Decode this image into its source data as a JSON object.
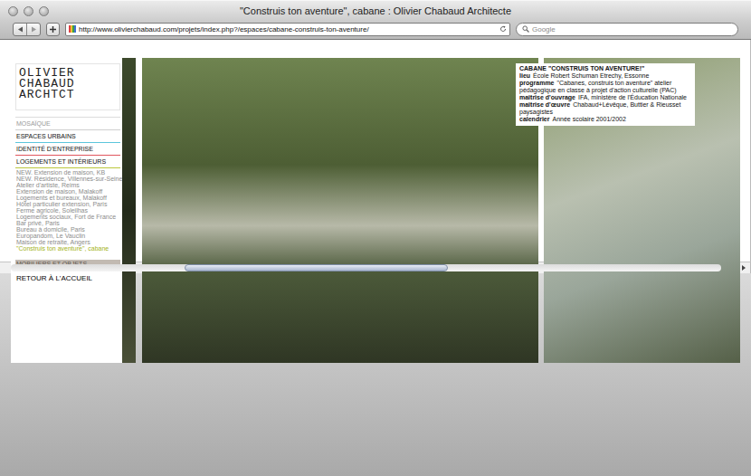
{
  "window": {
    "title": "\"Construis ton aventure\", cabane : Olivier Chabaud Architecte"
  },
  "toolbar": {
    "url": "http://www.olivierchabaud.com/projets/index.php?/espaces/cabane-construis-ton-aventure/",
    "search_placeholder": "Google"
  },
  "menu": {
    "logo": [
      "OLIVIER",
      "CHABAUD",
      "ARCHTCT"
    ],
    "items": [
      {
        "kind": "section",
        "label": "MOSAÏQUE",
        "muted": true,
        "color": "#cfcfcf"
      },
      {
        "kind": "section",
        "label": "ESPACES URBAINS",
        "muted": false,
        "color": "#5cc6dc"
      },
      {
        "kind": "section",
        "label": "IDENTITÉ D'ENTREPRISE",
        "muted": false,
        "color": "#e0565e"
      },
      {
        "kind": "section",
        "label": "LOGEMENTS ET INTÉRIEURS",
        "muted": false,
        "color": "#bcc83c",
        "children": [
          {
            "label": "NEW. Extension de maison, KB",
            "selected": false
          },
          {
            "label": "NEW. Résidence, Villennes-sur-Seine",
            "selected": false
          },
          {
            "label": "Atelier d'artiste, Reims",
            "selected": false
          },
          {
            "label": "Extension de maison, Malakoff",
            "selected": false
          },
          {
            "label": "Logements et bureaux, Malakoff",
            "selected": false
          },
          {
            "label": "Hôtel particulier extension, Paris",
            "selected": false
          },
          {
            "label": "Ferme agricole, Soleilhas",
            "selected": false
          },
          {
            "label": "Logements sociaux, Fort de France",
            "selected": false
          },
          {
            "label": "Bar privé, Paris",
            "selected": false
          },
          {
            "label": "Bureau à domicile, Paris",
            "selected": false
          },
          {
            "label": "Europandom, Le Vauclin",
            "selected": false
          },
          {
            "label": "Maison de retraite, Angers",
            "selected": false
          },
          {
            "label": "\"Construis ton aventure\", cabane",
            "selected": true
          }
        ]
      },
      {
        "kind": "bar",
        "label": "MOBILIERS ET OBJETS",
        "muted": true,
        "color": "#c2bab2"
      },
      {
        "kind": "link",
        "label": "RETOUR À L'ACCUEIL",
        "muted": false,
        "color": "#000000"
      }
    ]
  },
  "info": {
    "title": "CABANE \"CONSTRUIS TON AVENTURE!\"",
    "rows": [
      {
        "label": "lieu",
        "value": "École Robert Schuman Etrechy, Essonne"
      },
      {
        "label": "programme",
        "value": "\"Cabanes, construis ton aventure\" atelier pédagogique en classe à projet d'action culturelle (PAC)"
      },
      {
        "label": "maîtrise d'ouvrage",
        "value": "IFA, ministère de l'Éducation Nationale"
      },
      {
        "label": "maîtrise d'œuvre",
        "value": "Chabaud+Lévêque, Buttier & Rieusset paysagistes"
      },
      {
        "label": "calendrier",
        "value": "Année scolaire 2001/2002"
      }
    ]
  },
  "scrollbar": {
    "offset": 0.245,
    "level": 0.37
  }
}
